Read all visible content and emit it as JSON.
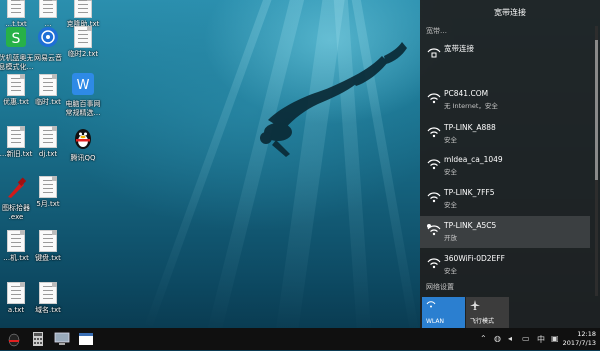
{
  "desktop": {
    "icons": [
      {
        "id": "txt-top1",
        "label": "…t.txt",
        "kind": "doc"
      },
      {
        "id": "txt-top2",
        "label": "…",
        "kind": "doc"
      },
      {
        "id": "txt-top3",
        "label": "克隆助.txt",
        "kind": "doc"
      },
      {
        "id": "wps",
        "label": "优机蓝奥无\n息模式化…",
        "kind": "wps"
      },
      {
        "id": "music",
        "label": "网易云音",
        "kind": "music"
      },
      {
        "id": "txt-mid",
        "label": "临时2.txt",
        "kind": "doc"
      },
      {
        "id": "txt-4",
        "label": "优惠.txt",
        "kind": "doc"
      },
      {
        "id": "txt-5",
        "label": "临时.txt",
        "kind": "doc"
      },
      {
        "id": "wps-office",
        "label": "电脑百事网\n常规精选…",
        "kind": "wpsw"
      },
      {
        "id": "txt-6",
        "label": "…新旧.txt",
        "kind": "doc"
      },
      {
        "id": "txt-7",
        "label": "dj.txt",
        "kind": "doc"
      },
      {
        "id": "qq",
        "label": "腾讯QQ",
        "kind": "qq"
      },
      {
        "id": "exe",
        "label": "图标拾器\n.exe",
        "kind": "exe"
      },
      {
        "id": "txt-8",
        "label": "5月.txt",
        "kind": "doc"
      },
      {
        "id": "txt-9",
        "label": "…机.txt",
        "kind": "doc"
      },
      {
        "id": "txt-10",
        "label": "键盘.txt",
        "kind": "doc"
      },
      {
        "id": "txt-11",
        "label": "a.txt",
        "kind": "doc"
      },
      {
        "id": "txt-12",
        "label": "域名.txt",
        "kind": "doc"
      }
    ]
  },
  "panel": {
    "title": "宽带连接",
    "sub": "宽带…",
    "networks": [
      {
        "name": "宽带连接",
        "status": "",
        "type": "dialup"
      },
      {
        "name": "PC841.COM",
        "status": "无 Internet，安全",
        "type": "wifi"
      },
      {
        "name": "TP-LINK_A888",
        "status": "安全",
        "type": "wifi"
      },
      {
        "name": "mldea_ca_1049",
        "status": "安全",
        "type": "wifi"
      },
      {
        "name": "TP-LINK_7FF5",
        "status": "安全",
        "type": "wifi"
      },
      {
        "name": "TP-LINK_A5C5",
        "status": "开放",
        "type": "wifi-open"
      },
      {
        "name": "360WiFi-0D2EFF",
        "status": "安全",
        "type": "wifi"
      }
    ],
    "settings_link": "网络设置",
    "tiles": [
      {
        "label": "WLAN",
        "active": true
      },
      {
        "label": "飞行模式",
        "active": false
      }
    ]
  },
  "taskbar": {
    "ime": "中",
    "time": "12:18",
    "date": "2017/7/13"
  },
  "colors": {
    "accent": "#2b7fd0",
    "panel": "#1f1f1f",
    "tile_inactive": "#3c3c3c"
  }
}
